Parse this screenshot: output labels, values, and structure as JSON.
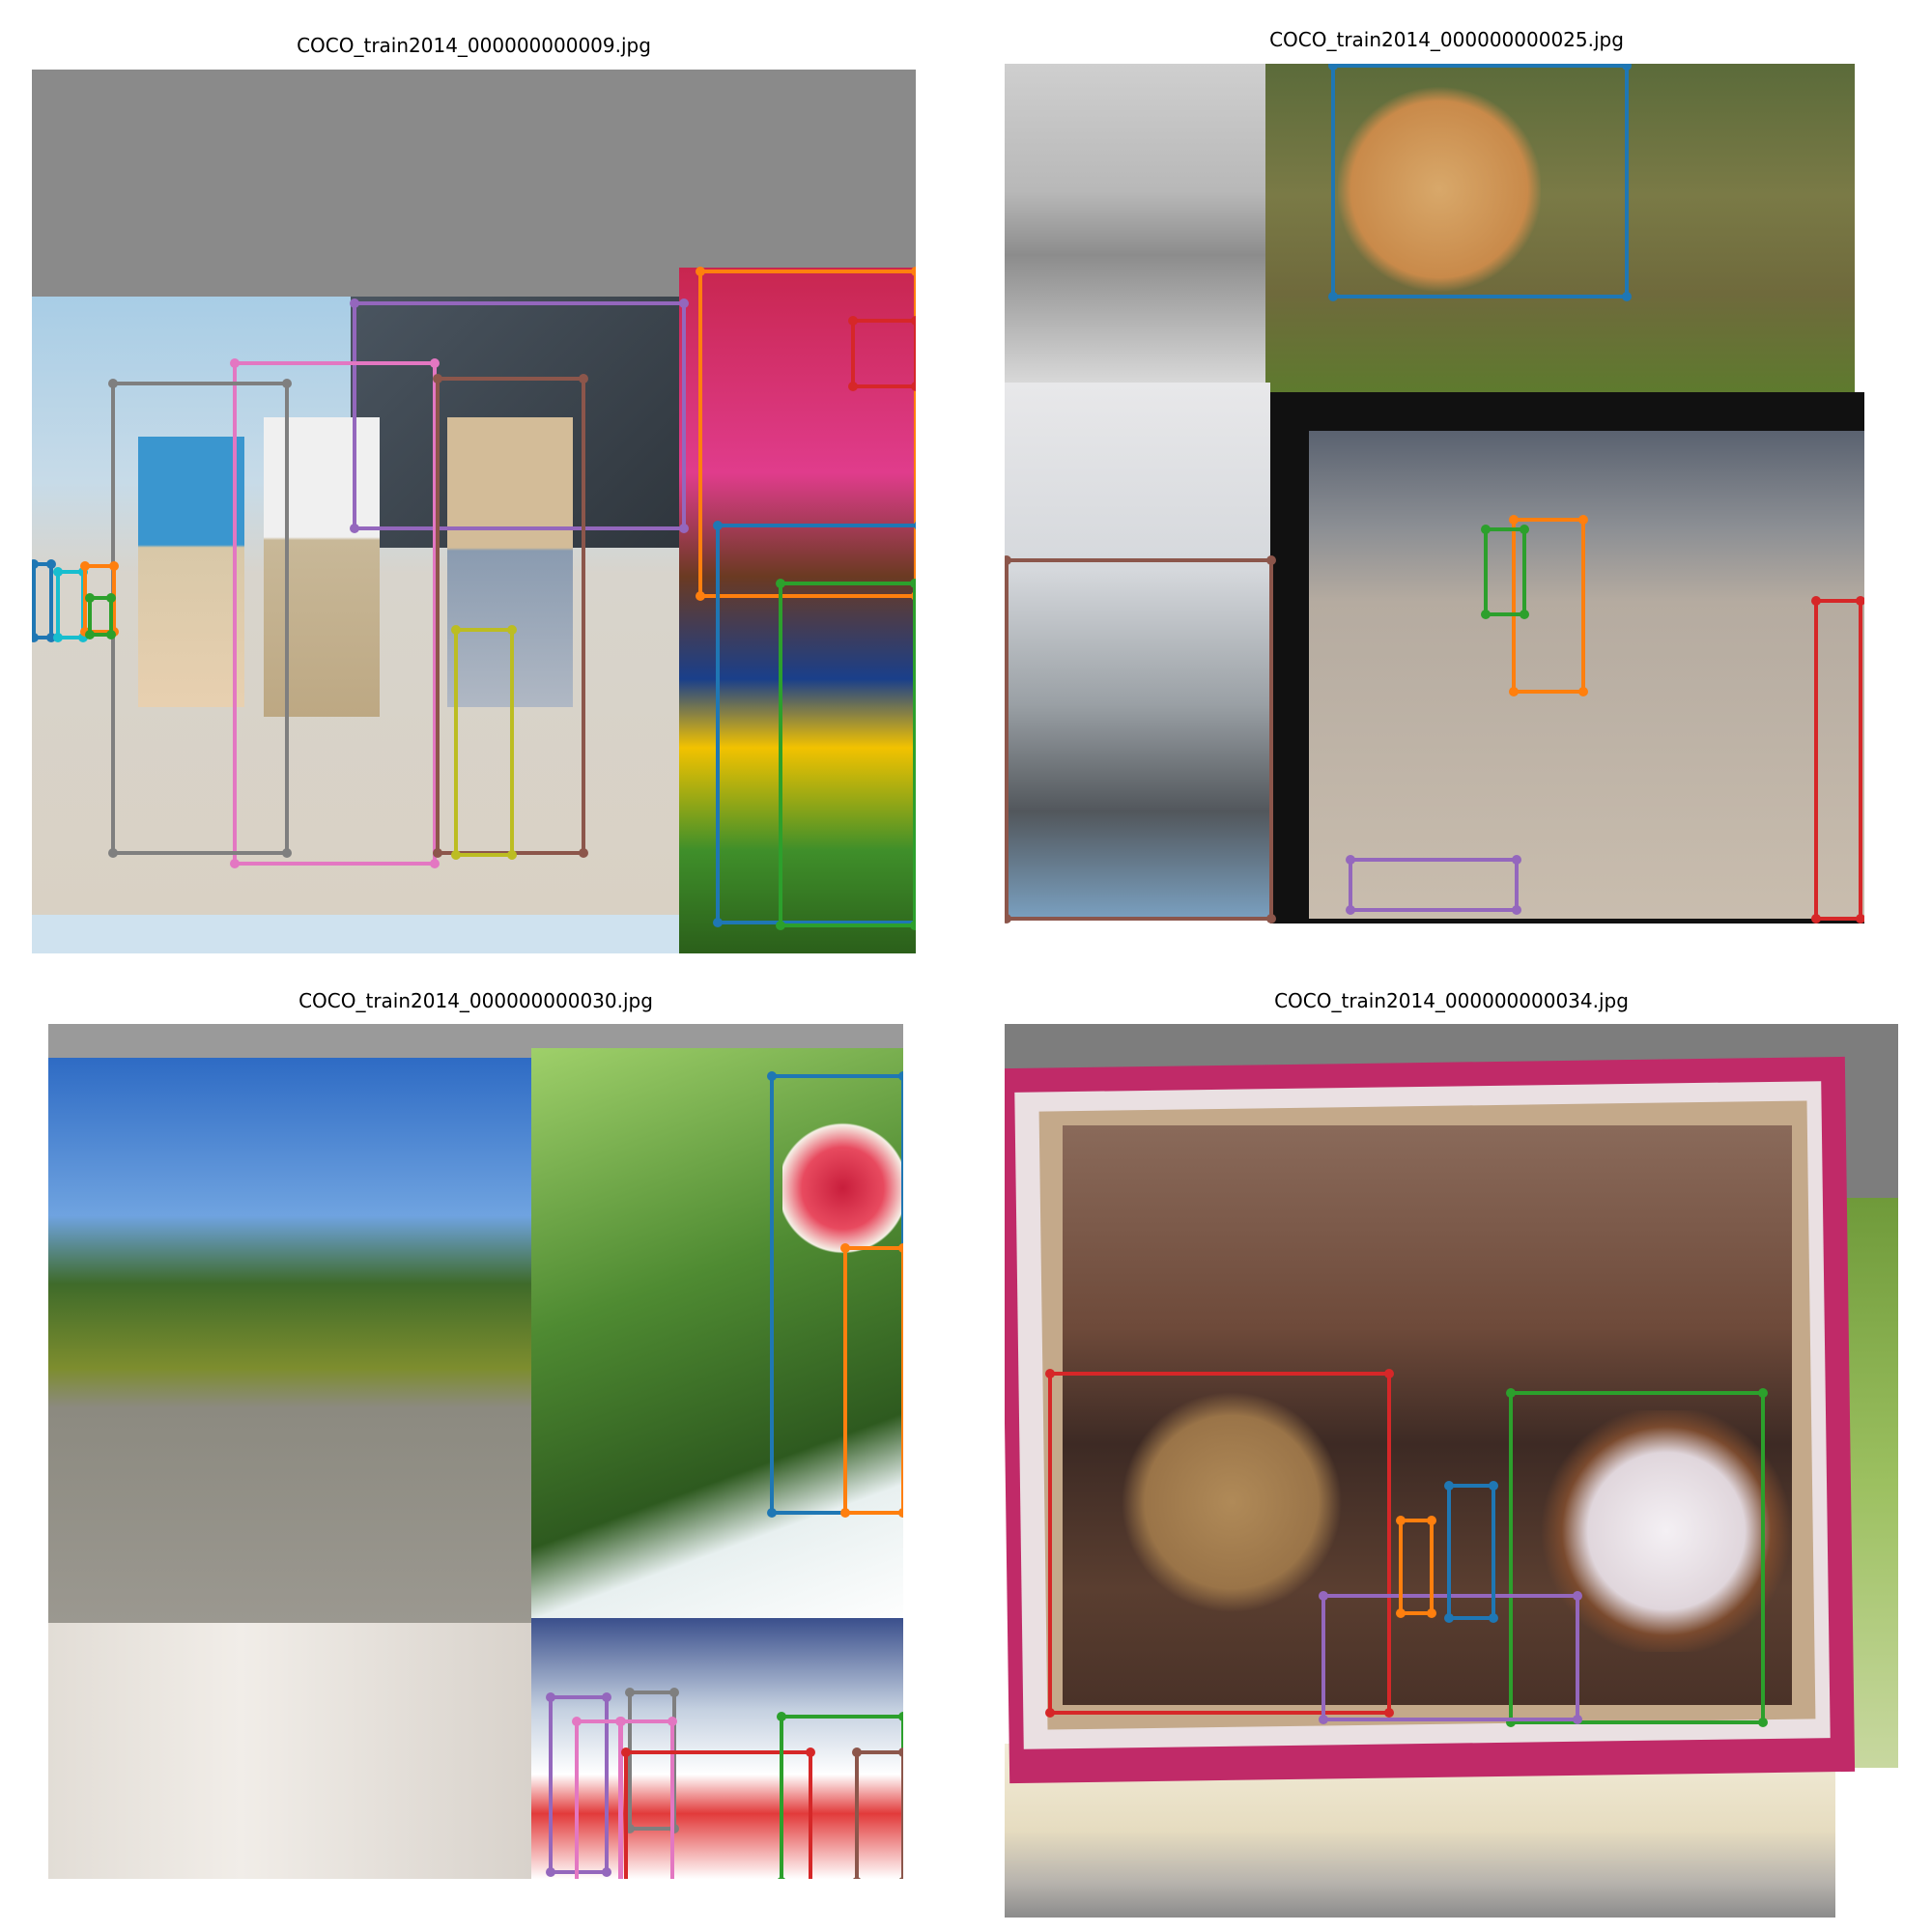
{
  "panels": [
    {
      "title": "COCO_train2014_000000000009.jpg"
    },
    {
      "title": "COCO_train2014_000000000025.jpg"
    },
    {
      "title": "COCO_train2014_000000000030.jpg"
    },
    {
      "title": "COCO_train2014_000000000034.jpg"
    }
  ],
  "box_colors": {
    "blue": "#1f77b4",
    "orange": "#ff7f0e",
    "green": "#2ca02c",
    "red": "#d62728",
    "purple": "#9467bd",
    "brown": "#8c564b",
    "pink": "#e377c2",
    "gray": "#7f7f7f",
    "olive": "#bcbd22"
  }
}
